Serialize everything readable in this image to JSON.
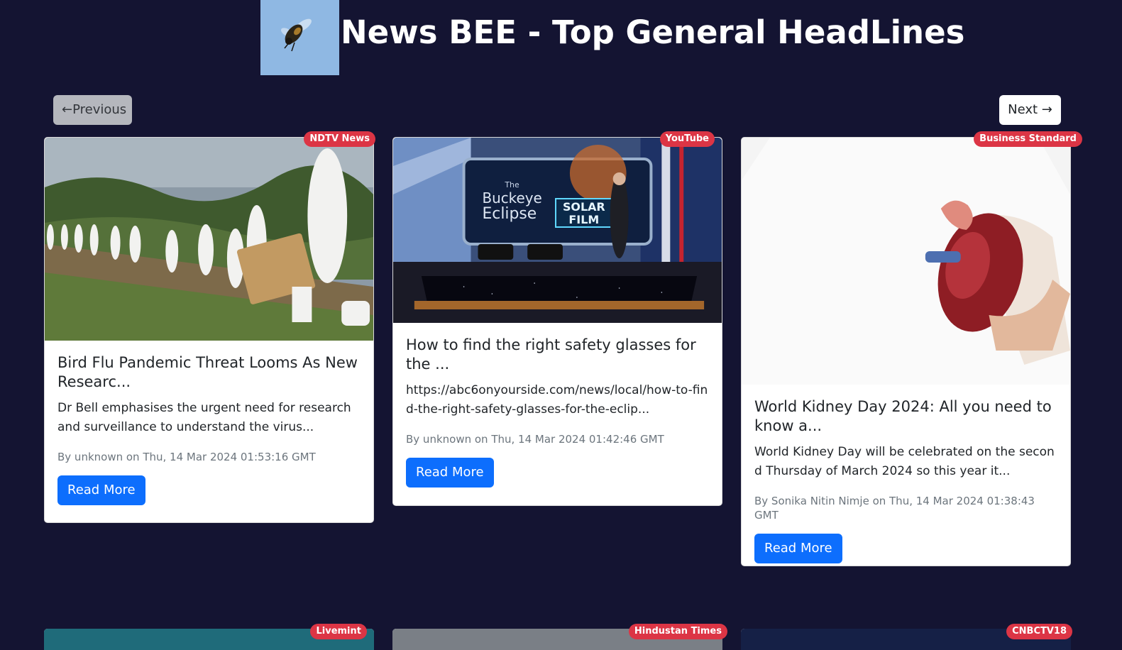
{
  "header": {
    "title": "News BEE - Top General HeadLines",
    "logo_icon": "bee-logo-icon"
  },
  "nav": {
    "previous_label": "←Previous",
    "next_label": "Next →"
  },
  "articles": [
    {
      "source": "NDTV News",
      "title": "Bird Flu Pandemic Threat Looms As New Researc...",
      "description": "Dr Bell emphasises the urgent need for research and surveillance to understand the virus...",
      "meta": "By unknown on Thu, 14 Mar 2024 01:53:16 GMT",
      "button": "Read More"
    },
    {
      "source": "YouTube",
      "title": "How to find the right safety glasses for the ...",
      "description": "https://abc6onyourside.com/news/local/how-to-find-the-right-safety-glasses-for-the-eclip...",
      "meta": "By unknown on Thu, 14 Mar 2024 01:42:46 GMT",
      "button": "Read More",
      "image_text": {
        "the": "The",
        "buckeye": "Buckeye",
        "eclipse": "Eclipse",
        "solar": "SOLAR",
        "film": "FILM"
      }
    },
    {
      "source": "Business Standard",
      "title": "World Kidney Day 2024: All you need to know a...",
      "description": "World Kidney Day will be celebrated on the second Thursday of March 2024 so this year it...",
      "meta": "By Sonika Nitin Nimje on Thu, 14 Mar 2024 01:38:43 GMT",
      "button": "Read More"
    }
  ],
  "next_row_sources": [
    "Livemint",
    "Hindustan Times",
    "CNBCTV18"
  ]
}
